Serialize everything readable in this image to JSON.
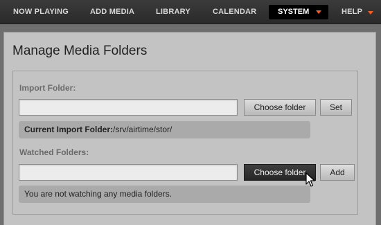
{
  "nav": {
    "items": [
      {
        "label": "NOW PLAYING"
      },
      {
        "label": "ADD MEDIA"
      },
      {
        "label": "LIBRARY"
      },
      {
        "label": "CALENDAR"
      },
      {
        "label": "SYSTEM",
        "active": true,
        "has_dropdown": true
      },
      {
        "label": "HELP",
        "has_dropdown": true
      }
    ],
    "caret_color": "#ff5a1f"
  },
  "page": {
    "title": "Manage Media Folders"
  },
  "import": {
    "label": "Import Folder:",
    "input_value": "",
    "choose_label": "Choose folder",
    "set_label": "Set",
    "current_label": "Current Import Folder:",
    "current_value": "/srv/airtime/stor/"
  },
  "watched": {
    "label": "Watched Folders:",
    "input_value": "",
    "choose_label": "Choose folder",
    "add_label": "Add",
    "status": "You are not watching any media folders."
  }
}
